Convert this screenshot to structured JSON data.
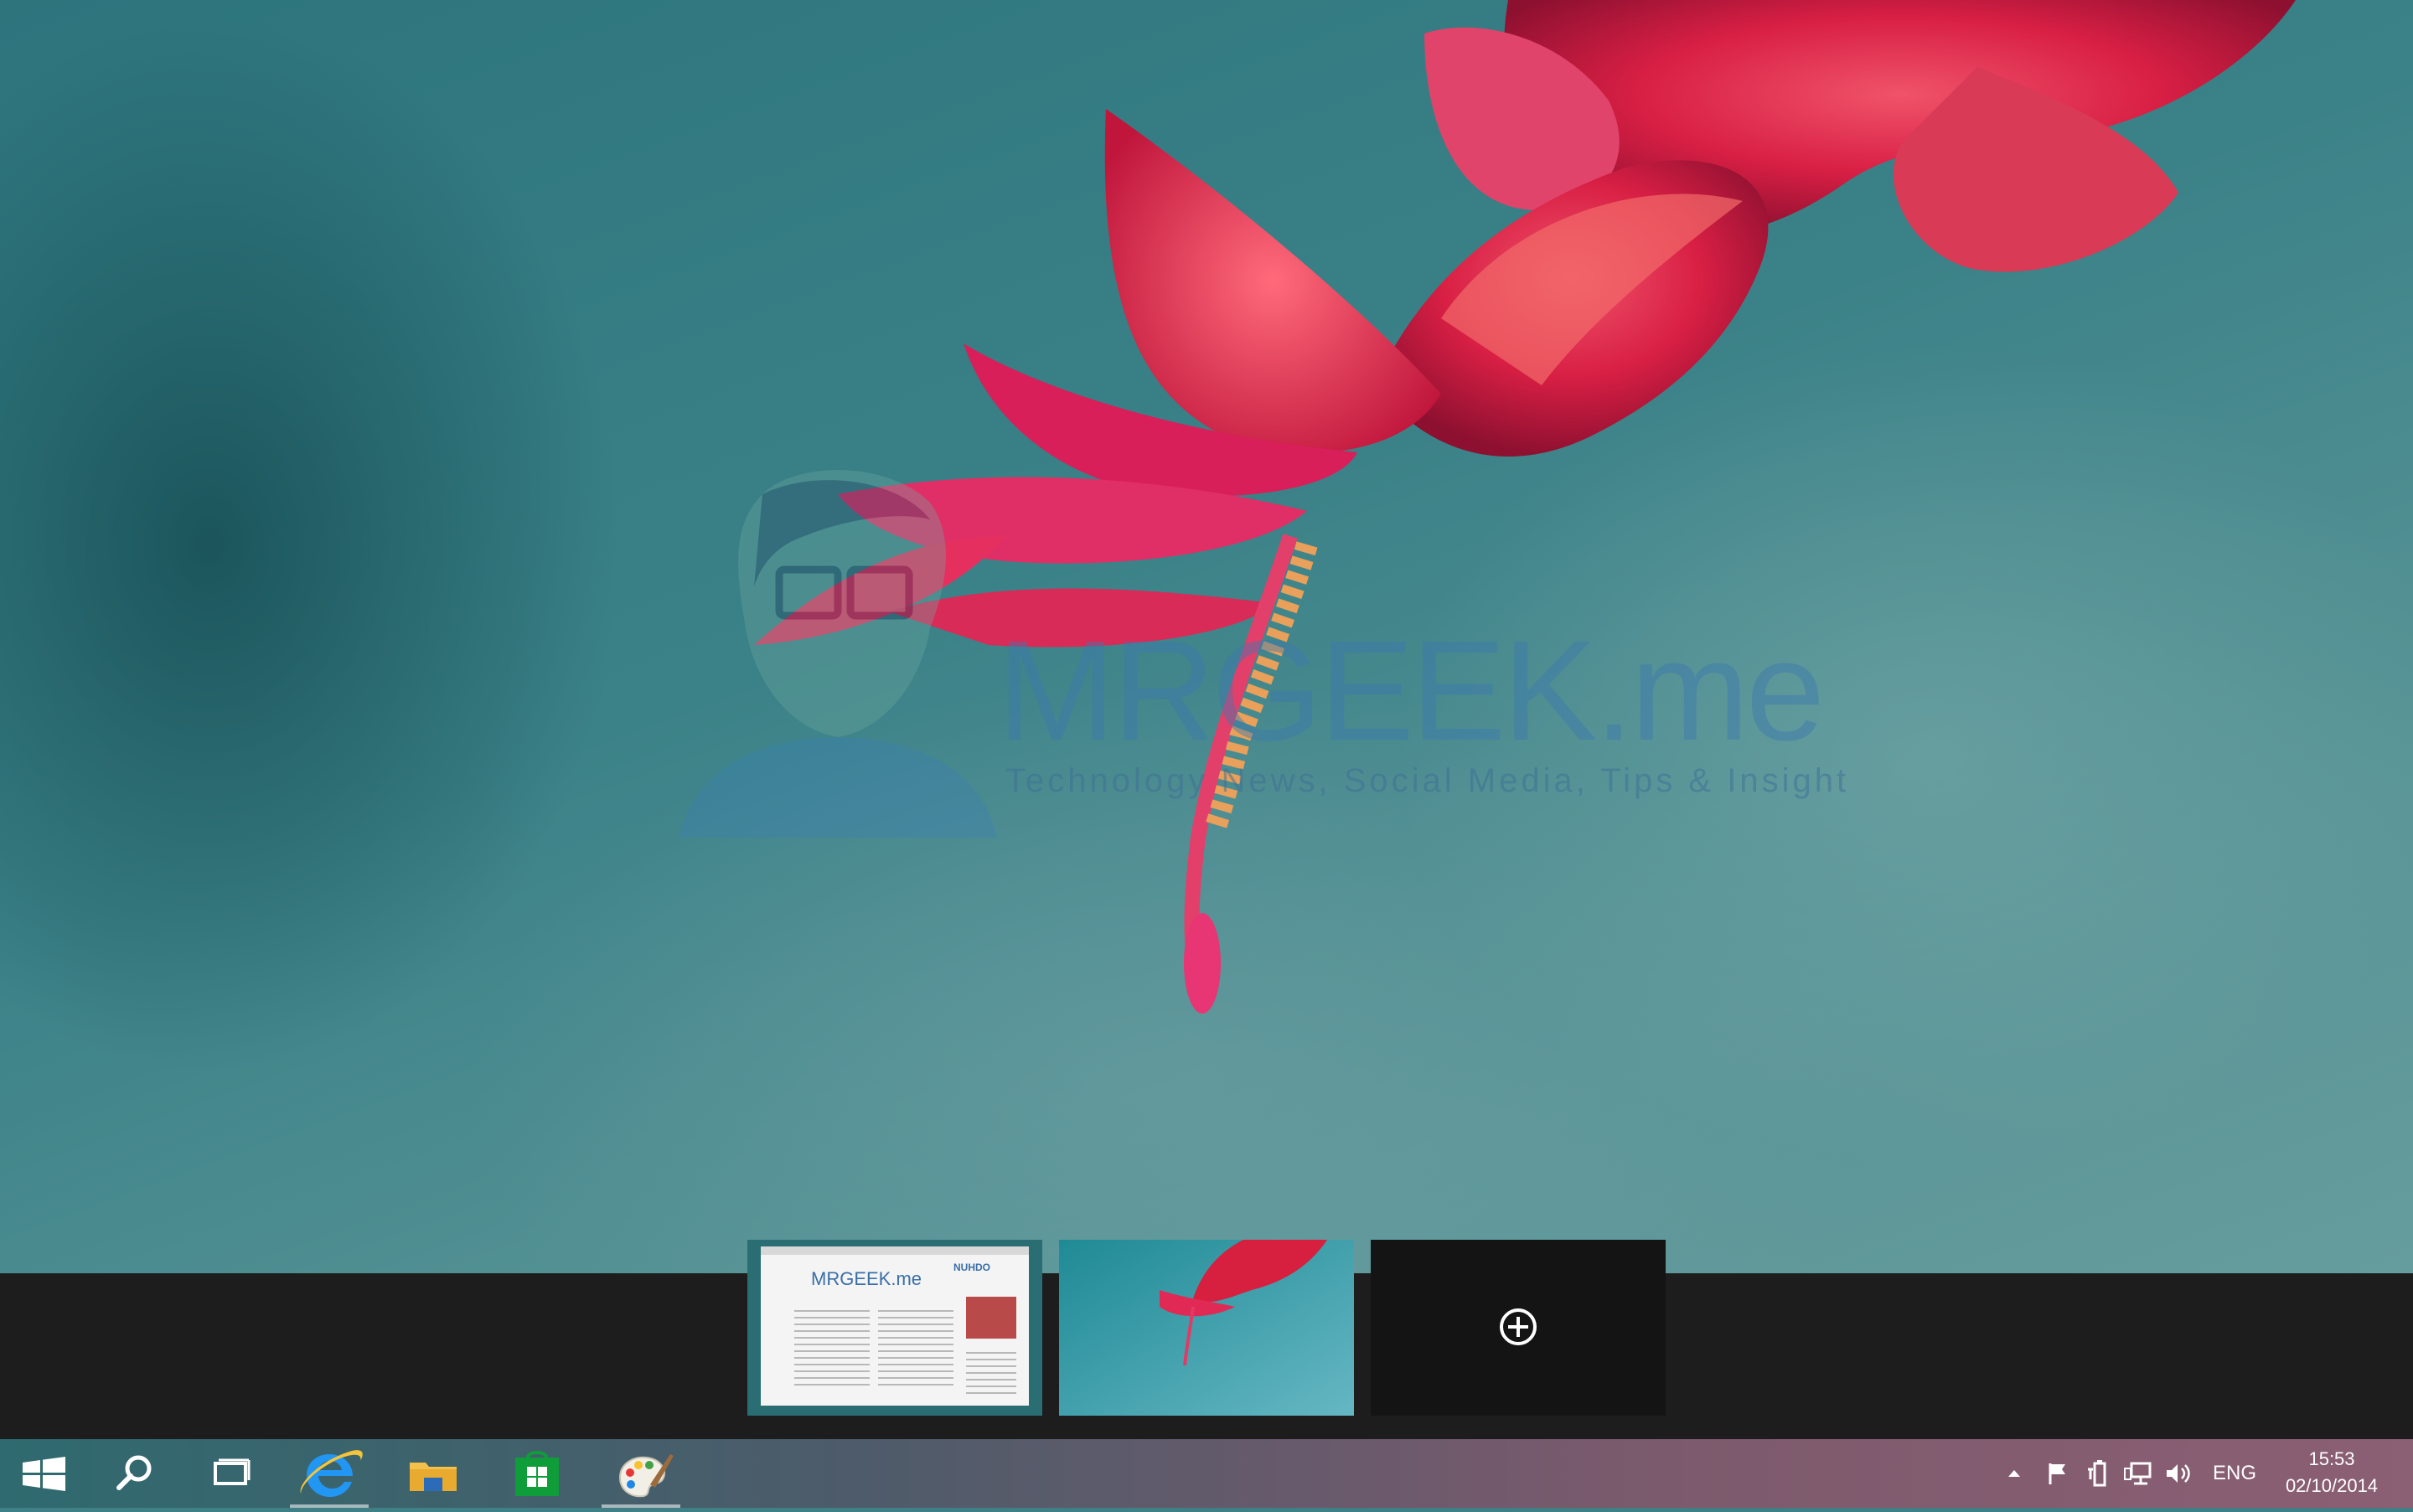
{
  "wallpaper": {
    "watermark_title": "MRGEEK.me",
    "watermark_subtitle": "Technology News, Social Media, Tips & Insight"
  },
  "virtual_desktops": {
    "desktops": [
      {
        "name": "desktop-1",
        "preview_logo": "MRGEEK.me",
        "preview_brand": "NUHDO"
      },
      {
        "name": "desktop-2"
      }
    ],
    "add_icon": "plus-circle-icon"
  },
  "taskbar": {
    "start_icon": "windows-logo-icon",
    "search_icon": "search-icon",
    "task_view_icon": "task-view-icon",
    "pinned": [
      {
        "name": "internet-explorer",
        "icon": "internet-explorer-icon",
        "running": true
      },
      {
        "name": "file-explorer",
        "icon": "folder-icon",
        "running": false
      },
      {
        "name": "store",
        "icon": "store-icon",
        "running": false
      },
      {
        "name": "paint",
        "icon": "paint-palette-icon",
        "running": true
      }
    ],
    "tray": {
      "language": "ENG",
      "time": "15:53",
      "date": "02/10/2014"
    }
  },
  "colors": {
    "taskbar_dark": "#1d1d1d",
    "accent_green": "#0f9d3a",
    "folder_yellow": "#f3c14b",
    "ie_blue": "#1c84d6"
  }
}
